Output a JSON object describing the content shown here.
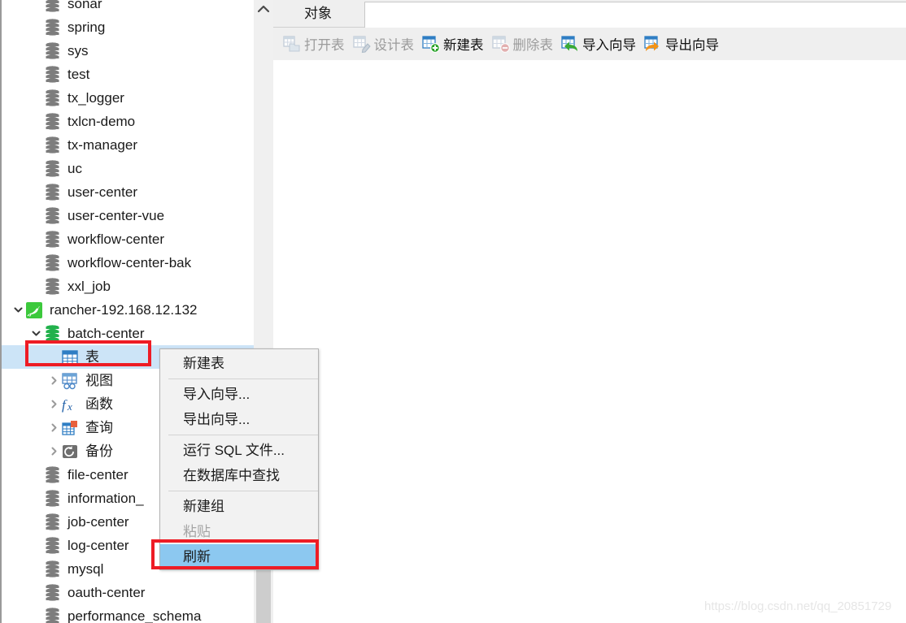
{
  "window": {
    "watermark": "https://blog.csdn.net/qq_20851729"
  },
  "tabbar": {
    "object_tab": "对象"
  },
  "toolbar": {
    "buttons": [
      {
        "label": "打开表",
        "icon": "open-table-icon",
        "enabled": false
      },
      {
        "label": "设计表",
        "icon": "design-table-icon",
        "enabled": false
      },
      {
        "label": "新建表",
        "icon": "new-table-icon",
        "enabled": true
      },
      {
        "label": "删除表",
        "icon": "delete-table-icon",
        "enabled": false
      },
      {
        "label": "导入向导",
        "icon": "import-wizard-icon",
        "enabled": true
      },
      {
        "label": "导出向导",
        "icon": "export-wizard-icon",
        "enabled": true
      }
    ]
  },
  "tree": {
    "items": [
      {
        "label": "sonar",
        "icon": "database-icon",
        "indent": 1,
        "chevron": "none",
        "selected": false,
        "partial_top": true
      },
      {
        "label": "spring",
        "icon": "database-icon",
        "indent": 1,
        "chevron": "none",
        "selected": false
      },
      {
        "label": "sys",
        "icon": "database-icon",
        "indent": 1,
        "chevron": "none",
        "selected": false
      },
      {
        "label": "test",
        "icon": "database-icon",
        "indent": 1,
        "chevron": "none",
        "selected": false
      },
      {
        "label": "tx_logger",
        "icon": "database-icon",
        "indent": 1,
        "chevron": "none",
        "selected": false
      },
      {
        "label": "txlcn-demo",
        "icon": "database-icon",
        "indent": 1,
        "chevron": "none",
        "selected": false
      },
      {
        "label": "tx-manager",
        "icon": "database-icon",
        "indent": 1,
        "chevron": "none",
        "selected": false
      },
      {
        "label": "uc",
        "icon": "database-icon",
        "indent": 1,
        "chevron": "none",
        "selected": false
      },
      {
        "label": "user-center",
        "icon": "database-icon",
        "indent": 1,
        "chevron": "none",
        "selected": false
      },
      {
        "label": "user-center-vue",
        "icon": "database-icon",
        "indent": 1,
        "chevron": "none",
        "selected": false
      },
      {
        "label": "workflow-center",
        "icon": "database-icon",
        "indent": 1,
        "chevron": "none",
        "selected": false
      },
      {
        "label": "workflow-center-bak",
        "icon": "database-icon",
        "indent": 1,
        "chevron": "none",
        "selected": false
      },
      {
        "label": "xxl_job",
        "icon": "database-icon",
        "indent": 1,
        "chevron": "none",
        "selected": false
      },
      {
        "label": "rancher-192.168.12.132",
        "icon": "mysql-connection-icon",
        "indent": 0,
        "chevron": "expanded",
        "selected": false
      },
      {
        "label": "batch-center",
        "icon": "database-open-icon",
        "indent": 1,
        "chevron": "expanded",
        "selected": false
      },
      {
        "label": "表",
        "icon": "tables-icon",
        "indent": 2,
        "chevron": "none",
        "selected": true
      },
      {
        "label": "视图",
        "icon": "views-icon",
        "indent": 2,
        "chevron": "collapsed",
        "selected": false
      },
      {
        "label": "函数",
        "icon": "functions-icon",
        "indent": 2,
        "chevron": "collapsed",
        "selected": false
      },
      {
        "label": "查询",
        "icon": "queries-icon",
        "indent": 2,
        "chevron": "collapsed",
        "selected": false
      },
      {
        "label": "备份",
        "icon": "backups-icon",
        "indent": 2,
        "chevron": "collapsed",
        "selected": false
      },
      {
        "label": "file-center",
        "icon": "database-icon",
        "indent": 1,
        "chevron": "none",
        "selected": false
      },
      {
        "label": "information_",
        "icon": "database-icon",
        "indent": 1,
        "chevron": "none",
        "selected": false
      },
      {
        "label": "job-center",
        "icon": "database-icon",
        "indent": 1,
        "chevron": "none",
        "selected": false
      },
      {
        "label": "log-center",
        "icon": "database-icon",
        "indent": 1,
        "chevron": "none",
        "selected": false
      },
      {
        "label": "mysql",
        "icon": "database-icon",
        "indent": 1,
        "chevron": "none",
        "selected": false
      },
      {
        "label": "oauth-center",
        "icon": "database-icon",
        "indent": 1,
        "chevron": "none",
        "selected": false
      },
      {
        "label": "performance_schema",
        "icon": "database-icon",
        "indent": 1,
        "chevron": "none",
        "selected": false
      }
    ]
  },
  "context_menu": {
    "items": [
      {
        "label": "新建表",
        "type": "item",
        "state": "normal"
      },
      {
        "label": "",
        "type": "separator",
        "state": "normal"
      },
      {
        "label": "导入向导...",
        "type": "item",
        "state": "normal"
      },
      {
        "label": "导出向导...",
        "type": "item",
        "state": "normal"
      },
      {
        "label": "",
        "type": "separator",
        "state": "normal"
      },
      {
        "label": "运行 SQL 文件...",
        "type": "item",
        "state": "normal"
      },
      {
        "label": "在数据库中查找",
        "type": "item",
        "state": "normal"
      },
      {
        "label": "",
        "type": "separator",
        "state": "normal"
      },
      {
        "label": "新建组",
        "type": "item",
        "state": "normal"
      },
      {
        "label": "粘贴",
        "type": "item",
        "state": "disabled"
      },
      {
        "label": "刷新",
        "type": "item",
        "state": "highlight"
      }
    ]
  },
  "colors": {
    "selection_blue": "#cce4f7",
    "menu_highlight": "#8cc8f0",
    "annotation_red": "#ee1c25",
    "toolbar_bg": "#efefef",
    "db_icon_grey": "#7d7d7d",
    "db_icon_green": "#22b14c"
  }
}
